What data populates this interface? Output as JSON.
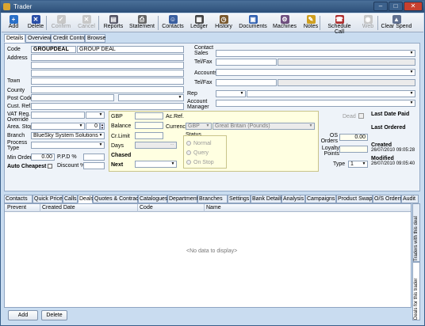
{
  "window": {
    "title": "Trader"
  },
  "toolbar": {
    "buttons": [
      {
        "label": "Add",
        "icon": "add-icon",
        "enabled": true
      },
      {
        "label": "Delete",
        "icon": "delete-icon",
        "enabled": true
      },
      {
        "label": "Confirm",
        "icon": "confirm-icon",
        "enabled": false
      },
      {
        "label": "Cancel",
        "icon": "cancel-icon",
        "enabled": false
      },
      {
        "label": "Reports",
        "icon": "reports-icon",
        "enabled": true
      },
      {
        "label": "Statement",
        "icon": "printer-icon",
        "enabled": true
      },
      {
        "label": "Contacts",
        "icon": "contacts-icon",
        "enabled": true
      },
      {
        "label": "Ledger",
        "icon": "ledger-icon",
        "enabled": true
      },
      {
        "label": "History",
        "icon": "history-icon",
        "enabled": true
      },
      {
        "label": "Documents",
        "icon": "documents-icon",
        "enabled": true
      },
      {
        "label": "Machines",
        "icon": "machines-icon",
        "enabled": true
      },
      {
        "label": "Notes",
        "icon": "notes-icon",
        "enabled": true
      },
      {
        "label": "Schedule Call",
        "icon": "phone-icon",
        "enabled": true
      },
      {
        "label": "Web",
        "icon": "web-icon",
        "enabled": false
      },
      {
        "label": "Clear Spend",
        "icon": "clear-spend-icon",
        "enabled": true
      }
    ]
  },
  "top_tabs": [
    "Details",
    "Overview",
    "Credit Control",
    "Browse"
  ],
  "form": {
    "code_label": "Code",
    "code_value": "GROUPDEAL",
    "name_value": "GROUP DEAL",
    "address_label": "Address",
    "town_label": "Town",
    "county_label": "County",
    "postcode_label": "Post Code",
    "custref_label": "Cust. Ref.",
    "vat_label": "VAT Reg. Override",
    "area_label": "Area. Stop",
    "area_stop_value": "0",
    "branch_label": "Branch",
    "branch_value": "BlueSky System Solutions",
    "process_label": "Process Type",
    "minorder_label": "Min Order",
    "minorder_value": "0.00",
    "ppd_label": "P.P.D %",
    "discount_label": "Discount %",
    "auto_cheapest_label": "Auto Cheapest",
    "contact_sales_label": "Contact Sales",
    "telfax_label": "Tel/Fax",
    "accounts_label": "Accounts",
    "telfax2_label": "Tel/Fax",
    "rep_label": "Rep",
    "account_manager_label": "Account Manager",
    "gbp_label": "GBP",
    "balance_label": "Balance",
    "crlimit_label": "Cr.Limit",
    "days_label": "Days",
    "chased_label": "Chased",
    "next_label": "Next",
    "acref_label": "Ac.Ref.",
    "currency_label": "Currency",
    "currency_code": "GBP",
    "currency_name": "Great Britain (Pounds)",
    "dead_label": "Dead",
    "status_label": "Status",
    "status_options": [
      "Normal",
      "Query",
      "On Stop"
    ],
    "os_orders_label": "OS Orders",
    "os_orders_value": "0.00",
    "loyalty_label": "Loyalty Points",
    "type_label": "Type",
    "type_value": "1",
    "last_date_paid_label": "Last Date Paid",
    "last_ordered_label": "Last Ordered",
    "created_label": "Created",
    "created_value": "26/07/2010 09:05:28",
    "modified_label": "Modified",
    "modified_value": "26/07/2010 09:05:40"
  },
  "bottom_tabs": [
    "Contacts",
    "Quick Price",
    "Calls",
    "Deals",
    "Quotes & Contracts",
    "Catalogues",
    "Departments",
    "Branches",
    "Settings",
    "Bank Details",
    "Analysis",
    "Campaigns",
    "Product Swaps",
    "O/S Orders",
    "Audit"
  ],
  "grid": {
    "columns": [
      "Prevent",
      "Created Date",
      "Code",
      "Name"
    ],
    "empty_text": "<No data to display>"
  },
  "side_tabs": [
    "Traders with this deal",
    "Deals for this trader"
  ],
  "buttons": {
    "add": "Add",
    "delete": "Delete"
  },
  "colors": {
    "title_bar": "#2c4f78",
    "window_bg": "#c9dcf0",
    "selected_tab": "#ffffff",
    "info_yellow": "#ffffe1"
  }
}
